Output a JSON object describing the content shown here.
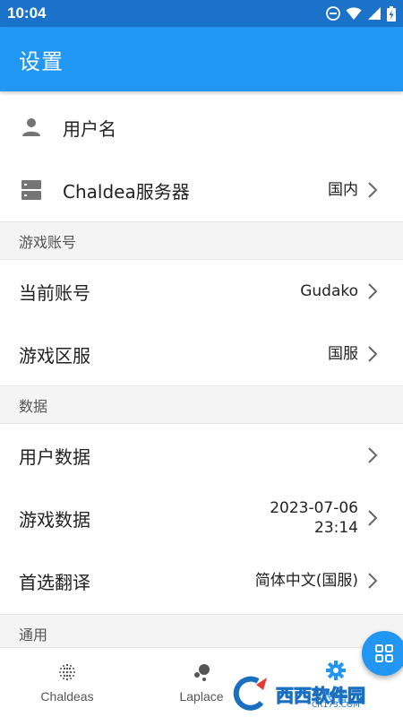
{
  "status_bar": {
    "time": "10:04"
  },
  "app_bar": {
    "title": "设置"
  },
  "rows": {
    "username": {
      "label": "用户名"
    },
    "server": {
      "label": "Chaldea服务器",
      "value": "国内"
    }
  },
  "sections": {
    "game_account": {
      "header": "游戏账号",
      "current_account": {
        "label": "当前账号",
        "value": "Gudako"
      },
      "game_region": {
        "label": "游戏区服",
        "value": "国服"
      }
    },
    "data": {
      "header": "数据",
      "user_data": {
        "label": "用户数据"
      },
      "game_data": {
        "label": "游戏数据",
        "value_date": "2023-07-06",
        "value_time": "23:14"
      },
      "preferred_translation": {
        "label": "首选翻译",
        "value": "简体中文(国服)"
      }
    },
    "general": {
      "header": "通用"
    }
  },
  "bottom_nav": {
    "items": [
      {
        "label": "Chaldeas"
      },
      {
        "label": "Laplace"
      },
      {
        "label": "设置"
      }
    ]
  },
  "watermark": {
    "text": "西西软件园",
    "sub": "CR173.COM"
  },
  "colors": {
    "primary": "#2196f3",
    "status_bar": "#1a73c8",
    "section_bg": "#f4f4f4",
    "icon_gray": "#757575"
  }
}
